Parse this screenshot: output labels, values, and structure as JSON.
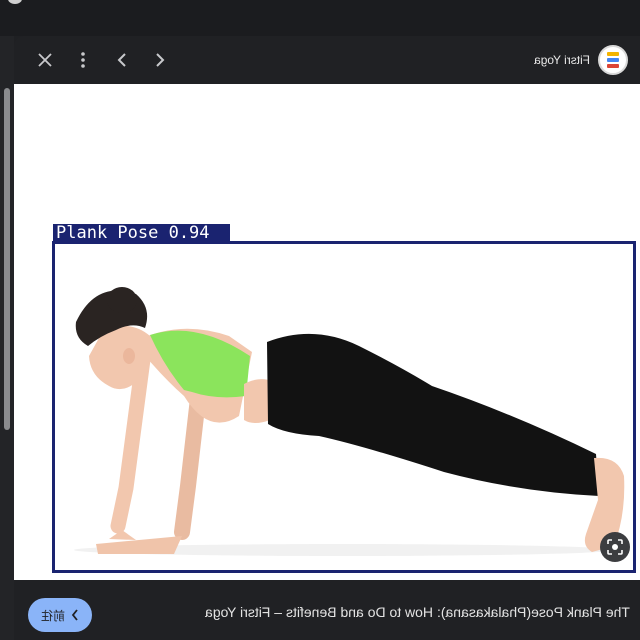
{
  "toolbar": {
    "close_icon": "close-icon",
    "more_icon": "more-vert-icon",
    "back_icon": "chevron-left-icon",
    "forward_icon": "chevron-right-icon",
    "site_name": "Fitsri Yoga",
    "site_logo_icon": "site-logo-icon"
  },
  "image": {
    "detection_label": "Plank_Pose 0.94",
    "detection_color": "#1a2370",
    "lens_icon": "lens-search-icon"
  },
  "bottom": {
    "caption": "The Plank Pose(Phalakasana): How to Do and Benefits – Fitsri Yoga",
    "visit_label": "前往",
    "visit_icon": "chevron-left-icon",
    "accent": "#8ab4f8"
  }
}
